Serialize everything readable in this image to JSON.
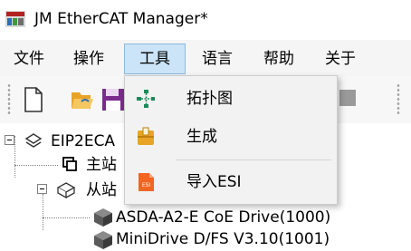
{
  "window": {
    "title": "JM EtherCAT Manager*"
  },
  "menu": [
    {
      "label": "文件"
    },
    {
      "label": "操作"
    },
    {
      "label": "工具"
    },
    {
      "label": "语言"
    },
    {
      "label": "帮助"
    },
    {
      "label": "关于"
    }
  ],
  "tools_menu": {
    "items": [
      {
        "label": "拓扑图",
        "icon": "topology-icon"
      },
      {
        "label": "生成",
        "icon": "generate-icon"
      },
      {
        "label": "导入ESI",
        "icon": "esi-file-icon"
      }
    ]
  },
  "tree": {
    "root": "EIP2ECA",
    "master": "主站",
    "slaves": "从站",
    "slave_items": [
      "ASDA-A2-E CoE Drive(1000)",
      "MiniDrive D/FS V3.10(1001)"
    ]
  },
  "colors": {
    "menu_highlight": "#cce4f7",
    "esi_icon": "#f26522",
    "generate_icon": "#e8a427"
  }
}
